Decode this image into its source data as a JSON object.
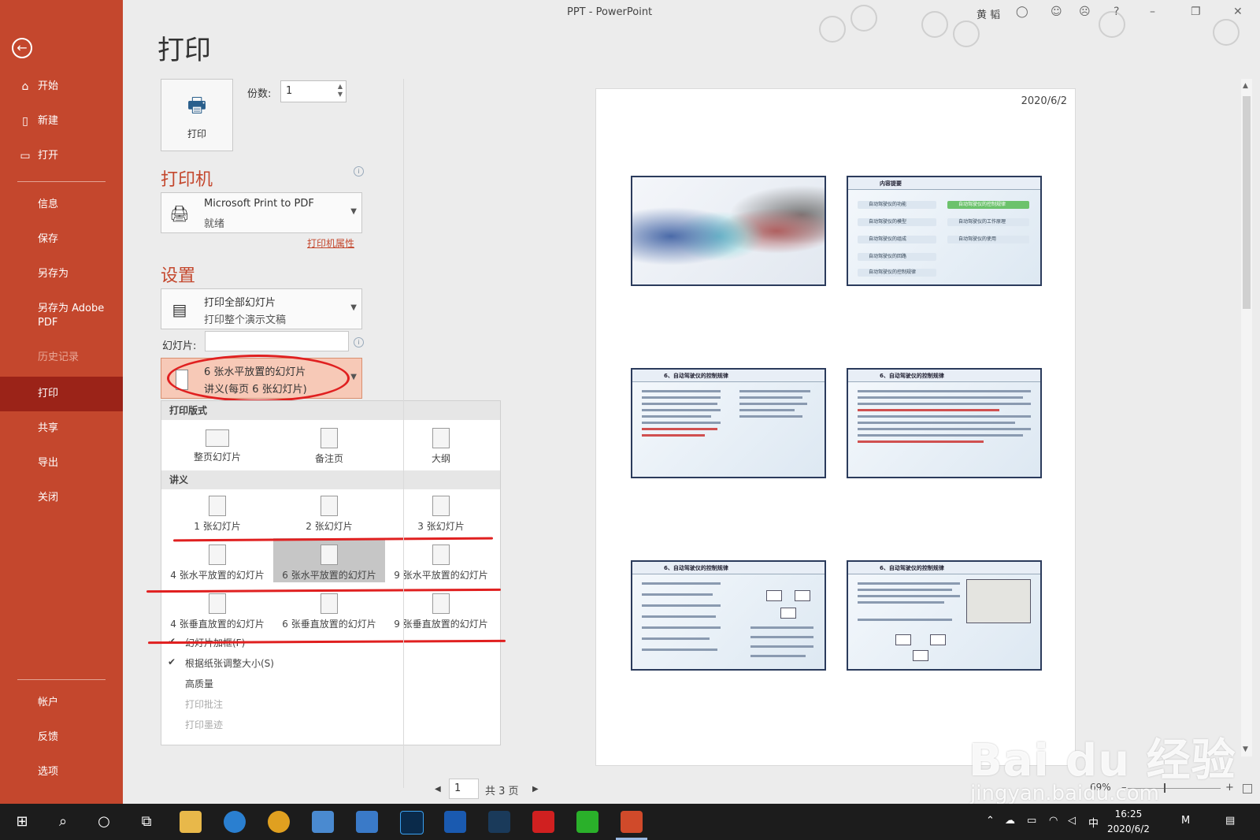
{
  "window": {
    "title": "PPT  -  PowerPoint",
    "user": "黄 韬",
    "controls": {
      "help": "?",
      "minimize": "–",
      "restore": "❐",
      "close": "✕"
    }
  },
  "sidebar": {
    "back_icon": "←",
    "items": [
      {
        "label": "开始",
        "icon": "⌂"
      },
      {
        "label": "新建",
        "icon": "▯"
      },
      {
        "label": "打开",
        "icon": "▭"
      },
      {
        "label": "信息"
      },
      {
        "label": "保存"
      },
      {
        "label": "另存为"
      },
      {
        "label": "另存为 Adobe PDF"
      },
      {
        "label": "历史记录"
      },
      {
        "label": "打印"
      },
      {
        "label": "共享"
      },
      {
        "label": "导出"
      },
      {
        "label": "关闭"
      },
      {
        "label": "帐户"
      },
      {
        "label": "反馈"
      },
      {
        "label": "选项"
      }
    ]
  },
  "print": {
    "title": "打印",
    "print_button_label": "打印",
    "copies_label": "份数:",
    "copies_value": "1",
    "printer_heading": "打印机",
    "printer_name": "Microsoft Print to PDF",
    "printer_status": "就绪",
    "printer_properties": "打印机属性",
    "settings_heading": "设置",
    "range_line1": "打印全部幻灯片",
    "range_line2": "打印整个演示文稿",
    "slides_label": "幻灯片:",
    "layout_line1": "6 张水平放置的幻灯片",
    "layout_line2": "讲义(每页 6 张幻灯片)"
  },
  "layout_panel": {
    "section_print_layout": "打印版式",
    "print_layout_options": [
      "整页幻灯片",
      "备注页",
      "大纲"
    ],
    "section_handouts": "讲义",
    "handout_row1": [
      "1 张幻灯片",
      "2 张幻灯片",
      "3 张幻灯片"
    ],
    "handout_row2": [
      "4 张水平放置的幻灯片",
      "6 张水平放置的幻灯片",
      "9 张水平放置的幻灯片"
    ],
    "handout_row3": [
      "4 张垂直放置的幻灯片",
      "6 张垂直放置的幻灯片",
      "9 张垂直放置的幻灯片"
    ],
    "checks": [
      {
        "label": "幻灯片加框(F)",
        "checked": true
      },
      {
        "label": "根据纸张调整大小(S)",
        "checked": true
      },
      {
        "label": "高质量",
        "checked": false
      },
      {
        "label": "打印批注",
        "checked": false
      },
      {
        "label": "打印墨迹",
        "checked": false
      }
    ],
    "check_mark": "✔"
  },
  "preview": {
    "date": "2020/6/2",
    "slide_titles": {
      "s2": "内容提要",
      "s3": "6、自动驾驶仪的控制规律",
      "s4": "6、自动驾驶仪的控制规律",
      "s5": "6、自动驾驶仪的控制规律",
      "s6": "6、自动驾驶仪的控制规律"
    },
    "agenda_left": [
      "自动驾驶仪的功能",
      "自动驾驶仪的模型",
      "自动驾驶仪的组成",
      "自动驾驶仪的回路",
      "自动驾驶仪的控制规律"
    ],
    "agenda_right": [
      "自动驾驶仪的控制规律",
      "自动驾驶仪的工作原理",
      "自动驾驶仪的使用"
    ]
  },
  "pager": {
    "prev": "◀",
    "current": "1",
    "total": "共 3 页",
    "next": "▶"
  },
  "zoom": {
    "label": "69%",
    "minus": "–",
    "plus": "+"
  },
  "watermark": {
    "brand": "Bai du 经验",
    "url": "jingyan.baidu.com"
  },
  "taskbar": {
    "start_icon": "⊞",
    "tray_ime": "中",
    "time": "16:25",
    "date": "2020/6/2"
  },
  "colors": {
    "sidebar": "#c4472d",
    "sidebar_active": "#9b2318",
    "accent": "#c4472d",
    "annotation_red": "#e02020"
  }
}
